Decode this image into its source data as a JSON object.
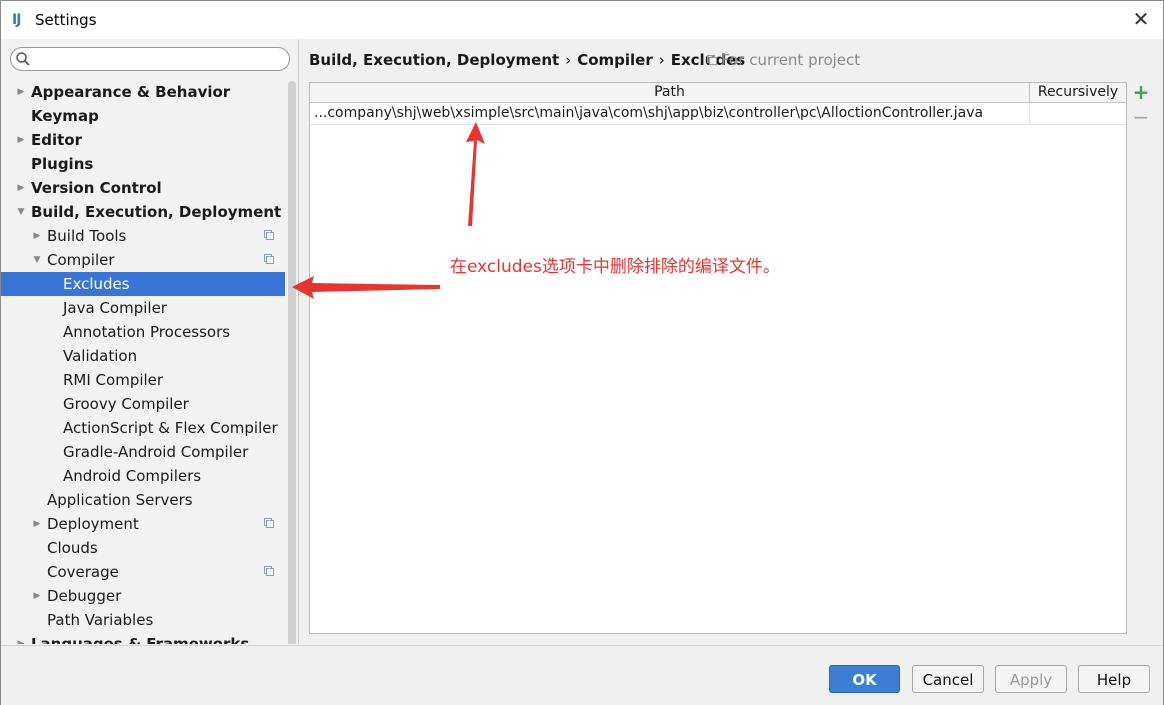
{
  "window": {
    "title": "Settings",
    "app_icon": "IJ"
  },
  "search": {
    "value": "",
    "placeholder": ""
  },
  "sidebar": {
    "items": [
      {
        "label": "Appearance & Behavior",
        "level": 0,
        "bold": true,
        "arrow": "right"
      },
      {
        "label": "Keymap",
        "level": 0,
        "bold": true,
        "arrow": ""
      },
      {
        "label": "Editor",
        "level": 0,
        "bold": true,
        "arrow": "right"
      },
      {
        "label": "Plugins",
        "level": 0,
        "bold": true,
        "arrow": ""
      },
      {
        "label": "Version Control",
        "level": 0,
        "bold": true,
        "arrow": "right"
      },
      {
        "label": "Build, Execution, Deployment",
        "level": 0,
        "bold": true,
        "arrow": "down"
      },
      {
        "label": "Build Tools",
        "level": 1,
        "bold": false,
        "arrow": "right",
        "project": true
      },
      {
        "label": "Compiler",
        "level": 1,
        "bold": false,
        "arrow": "down",
        "project": true
      },
      {
        "label": "Excludes",
        "level": 2,
        "bold": false,
        "arrow": "",
        "selected": true
      },
      {
        "label": "Java Compiler",
        "level": 2,
        "bold": false,
        "arrow": ""
      },
      {
        "label": "Annotation Processors",
        "level": 2,
        "bold": false,
        "arrow": ""
      },
      {
        "label": "Validation",
        "level": 2,
        "bold": false,
        "arrow": ""
      },
      {
        "label": "RMI Compiler",
        "level": 2,
        "bold": false,
        "arrow": ""
      },
      {
        "label": "Groovy Compiler",
        "level": 2,
        "bold": false,
        "arrow": ""
      },
      {
        "label": "ActionScript & Flex Compiler",
        "level": 2,
        "bold": false,
        "arrow": ""
      },
      {
        "label": "Gradle-Android Compiler",
        "level": 2,
        "bold": false,
        "arrow": ""
      },
      {
        "label": "Android Compilers",
        "level": 2,
        "bold": false,
        "arrow": ""
      },
      {
        "label": "Application Servers",
        "level": 1,
        "bold": false,
        "arrow": ""
      },
      {
        "label": "Deployment",
        "level": 1,
        "bold": false,
        "arrow": "right",
        "project": true
      },
      {
        "label": "Clouds",
        "level": 1,
        "bold": false,
        "arrow": ""
      },
      {
        "label": "Coverage",
        "level": 1,
        "bold": false,
        "arrow": "",
        "project": true
      },
      {
        "label": "Debugger",
        "level": 1,
        "bold": false,
        "arrow": "right"
      },
      {
        "label": "Path Variables",
        "level": 1,
        "bold": false,
        "arrow": ""
      },
      {
        "label": "Languages & Frameworks",
        "level": 0,
        "bold": true,
        "arrow": "right"
      }
    ]
  },
  "main": {
    "breadcrumb": [
      "Build, Execution, Deployment",
      "Compiler",
      "Excludes"
    ],
    "breadcrumb_sep": "›",
    "for_project": "For current project",
    "table": {
      "headers": [
        "Path",
        "Recursively"
      ],
      "rows": [
        {
          "path": "...company\\shj\\web\\xsimple\\src\\main\\java\\com\\shj\\app\\biz\\controller\\pc\\AlloctionController.java",
          "recursively": ""
        }
      ]
    },
    "tools": {
      "add": "+",
      "remove": "−"
    }
  },
  "annotation": {
    "text": "在excludes选项卡中删除排除的编译文件。",
    "color": "#e8342f"
  },
  "footer": {
    "ok": "OK",
    "cancel": "Cancel",
    "apply": "Apply",
    "help": "Help"
  },
  "colors": {
    "selection": "#3875d7",
    "ok_button": "#3a7fd5",
    "add_icon": "#3aa346"
  }
}
